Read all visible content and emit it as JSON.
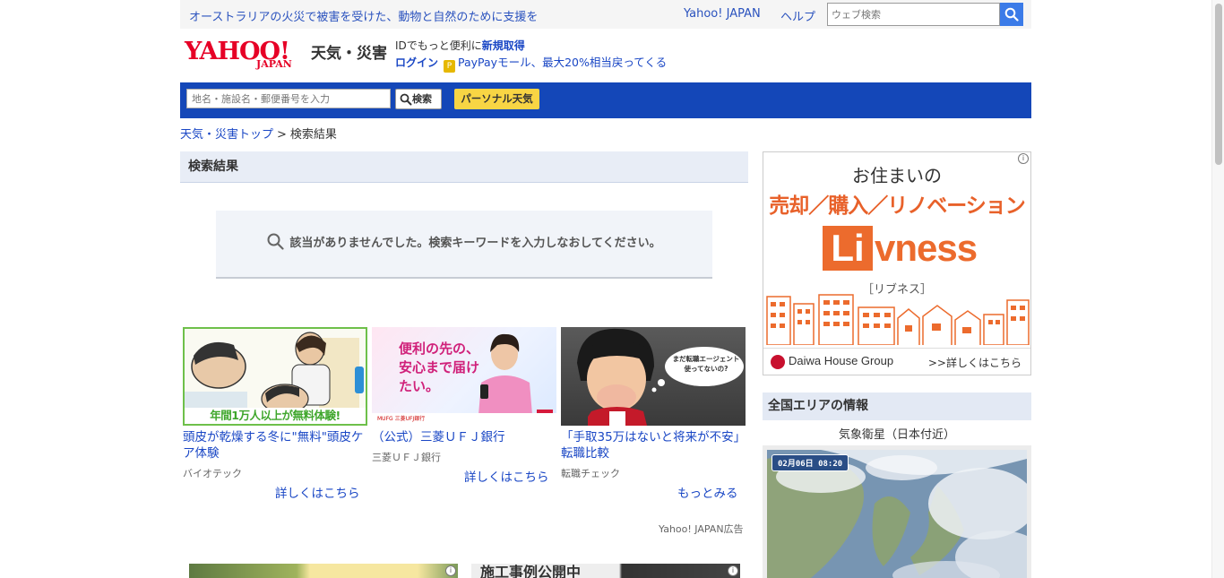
{
  "topbar": {
    "message": "オーストラリアの火災で被害を受けた、動物と自然のために支援を",
    "yahoo_japan": "Yahoo! JAPAN",
    "help": "ヘルプ",
    "web_search_placeholder": "ウェブ検索"
  },
  "header": {
    "logo_main": "YAHOO!",
    "logo_sub": "JAPAN",
    "service_name": "天気・災害",
    "id_text": "IDでもっと便利に",
    "register": "新規取得",
    "login": "ログイン",
    "promo": "PayPayモール、最大20%相当戻ってくる"
  },
  "search_bar": {
    "placeholder": "地名・施設名・郵便番号を入力",
    "search_button": "検索",
    "personal_button": "パーソナル天気"
  },
  "breadcrumb": {
    "home": "天気・災害トップ",
    "separator": ">",
    "current": "検索結果"
  },
  "results": {
    "heading": "検索結果",
    "no_result": "該当がありませんでした。検索キーワードを入力しなおしてください。"
  },
  "ads": [
    {
      "image_caption": "年間1万人以上が無料体験!",
      "title": "頭皮が乾燥する冬に\"無料\"頭皮ケア体験",
      "source": "バイオテック",
      "more": "詳しくはこちら"
    },
    {
      "image_text": "便利の先の、安心まで届けたい。",
      "image_brand": "MUFG 三菱UFJ銀行",
      "title": "（公式）三菱ＵＦＪ銀行",
      "source": "三菱ＵＦＪ銀行",
      "more": "詳しくはこちら"
    },
    {
      "image_bubble": "まだ転職エージェント使ってないの?",
      "title": "「手取35万はないと将来が不安」転職比較",
      "source": "転職チェック",
      "more": "もっとみる"
    }
  ],
  "ad_label": "Yahoo! JAPAN広告",
  "bottom_ad_text": "施工事例公開中",
  "right_ad": {
    "line1": "お住まいの",
    "line2": "売却／購入／リノベーション",
    "logo_box": "Li",
    "logo_rest": "vness",
    "sub": "［リブネス］",
    "company": "Daiwa House Group",
    "more": ">>詳しくはこちら"
  },
  "area": {
    "heading": "全国エリアの情報",
    "satellite_title": "気象衛星（日本付近）",
    "satellite_stamp": "02月06日 08:20"
  },
  "colors": {
    "link": "#1a47c5",
    "band": "#1447b8",
    "accent_yellow": "#f8d544",
    "yahoo_red": "#e60026",
    "livness_orange": "#ec6b2d"
  }
}
